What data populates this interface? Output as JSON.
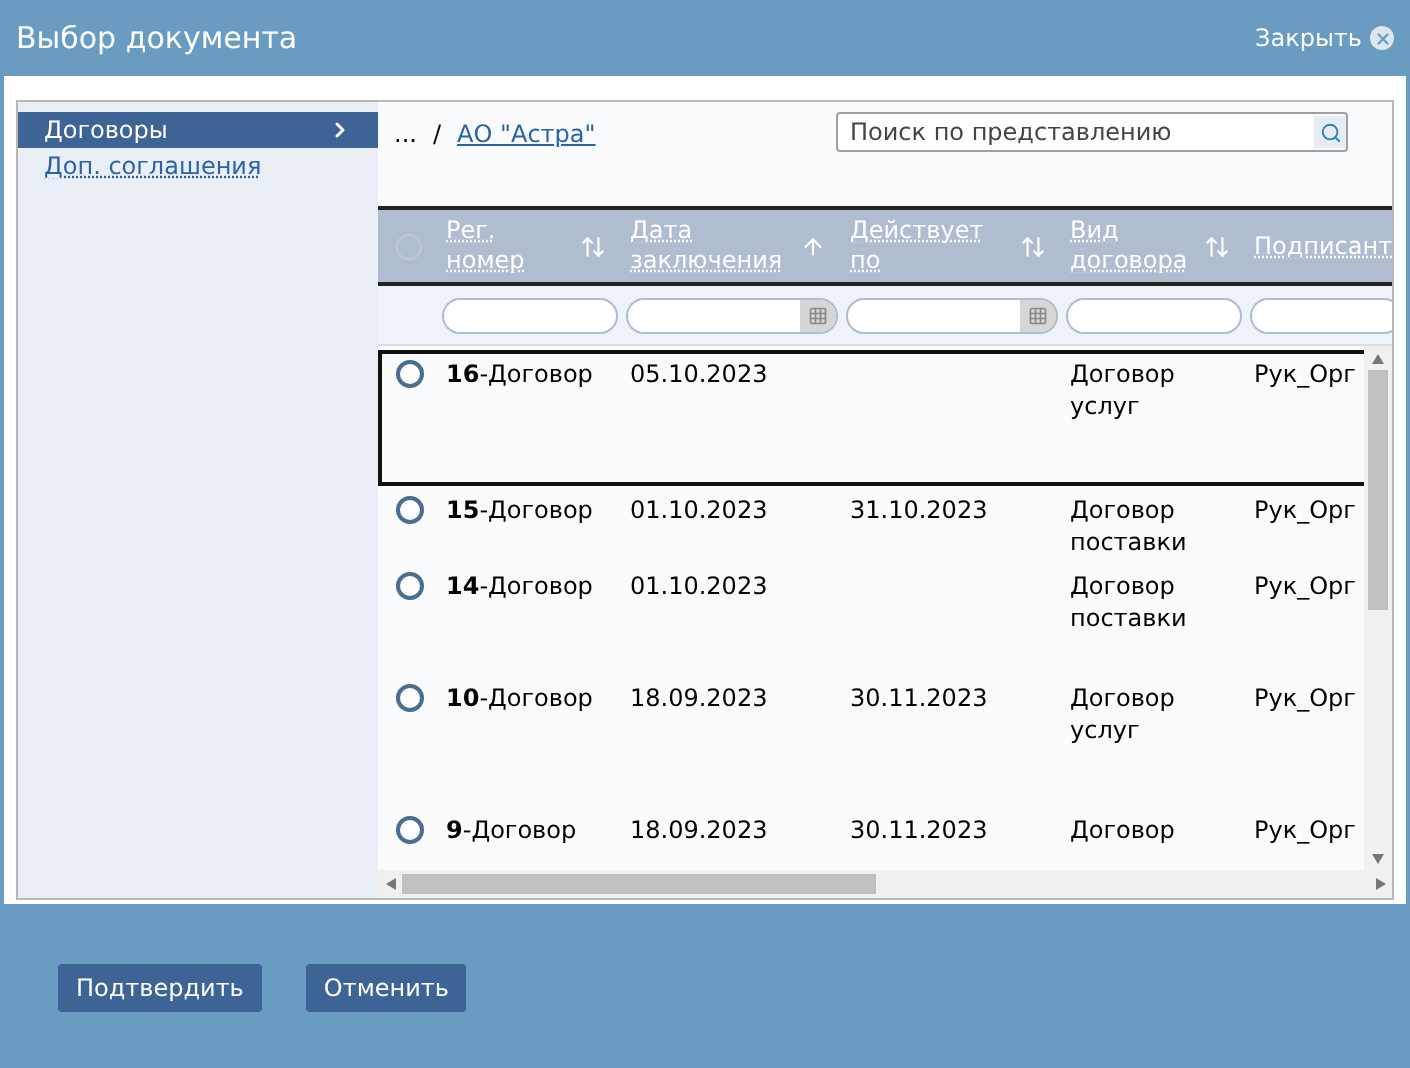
{
  "window": {
    "title": "Выбор документа",
    "close_label": "Закрыть"
  },
  "sidebar": {
    "items": [
      {
        "label": "Договоры",
        "selected": true
      },
      {
        "label": "Доп. соглашения",
        "selected": false
      }
    ]
  },
  "breadcrumb": {
    "root": "...",
    "separator": "/",
    "current": "АО \"Астра\""
  },
  "search": {
    "placeholder": "Поиск по представлению"
  },
  "table": {
    "select_all": {
      "checked": false
    },
    "columns": [
      {
        "label": "Рег. номер",
        "sorted": false,
        "calendar": false
      },
      {
        "label": "Дата заключения",
        "sorted": true,
        "calendar": true
      },
      {
        "label": "Действует по",
        "sorted": false,
        "calendar": true
      },
      {
        "label": "Вид договора",
        "sorted": false,
        "calendar": false
      },
      {
        "label": "Подписант",
        "calendar": false
      }
    ],
    "rows": [
      {
        "selected": true,
        "checked": false,
        "cells": [
          "**16**-Договор",
          "05.10.2023",
          "",
          "Договор услуг",
          "Рук_Орг"
        ]
      },
      {
        "selected": false,
        "checked": false,
        "cells": [
          "**15**-Договор",
          "01.10.2023",
          "31.10.2023",
          "Договор поставки",
          "Рук_Орг"
        ]
      },
      {
        "selected": false,
        "checked": false,
        "cells": [
          "**14**-Договор",
          "01.10.2023",
          "",
          "Договор поставки",
          "Рук_Орг"
        ]
      },
      {
        "selected": false,
        "checked": false,
        "cells": [
          "**10**-Договор",
          "18.09.2023",
          "30.11.2023",
          "Договор услуг",
          "Рук_Орг"
        ]
      },
      {
        "selected": false,
        "checked": false,
        "cells": [
          "**9**-Договор",
          "18.09.2023",
          "30.11.2023",
          "Договор",
          "Рук_Орг"
        ]
      }
    ]
  },
  "buttons": [
    {
      "label": "Подтвердить"
    },
    {
      "label": "Отменить"
    }
  ]
}
